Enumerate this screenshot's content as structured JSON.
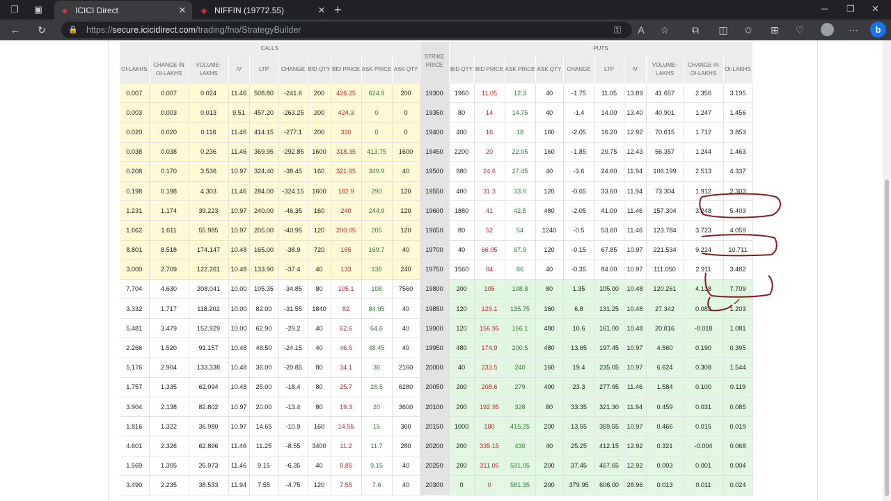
{
  "browser": {
    "tabs": [
      {
        "title": "ICICI Direct",
        "active": true
      },
      {
        "title": "NIFFIN (19772.55)",
        "active": false
      }
    ],
    "url_prefix": "https://",
    "url_host": "secure.icicidirect.com",
    "url_path": "/trading/fno/StrategyBuilder"
  },
  "colors": {
    "accent": "#1a73e8",
    "itm_calls": "#fff9d6",
    "itm_puts": "#e2f7e1",
    "bid_price": "#c62828",
    "ask_price": "#2e7d32",
    "annotation": "#8b1a1a"
  },
  "option_chain": {
    "calls_label": "CALLS",
    "puts_label": "PUTS",
    "headers": [
      "OI-LAKHS",
      "CHANGE IN OI-LAKHS",
      "VOLUME-LAKHS",
      "IV",
      "LTP",
      "CHANGE",
      "BID QTY",
      "BID PRICE",
      "ASK PRICE",
      "ASK QTY",
      "STRIKE PRICE",
      "BID QTY",
      "BID PRICE",
      "ASK PRICE",
      "ASK QTY",
      "CHANGE",
      "LTP",
      "IV",
      "VOLUME-LAKHS",
      "CHANGE IN OI-LAKHS",
      "OI-LAKHS"
    ],
    "rows": [
      [
        "0.007",
        "0.007",
        "0.024",
        "11.46",
        "508.80",
        "-241.6",
        "200",
        "426.25",
        "624.9",
        "200",
        "19300",
        "1960",
        "11.05",
        "12.3",
        "40",
        "-1.75",
        "11.05",
        "13.89",
        "41.657",
        "2.356",
        "3.195"
      ],
      [
        "0.003",
        "0.003",
        "0.013",
        "9.51",
        "457.20",
        "-263.25",
        "200",
        "424.3",
        "0",
        "0",
        "19350",
        "80",
        "14",
        "14.75",
        "40",
        "-1.4",
        "14.00",
        "13.40",
        "40.901",
        "1.247",
        "1.456"
      ],
      [
        "0.020",
        "0.020",
        "0.116",
        "11.46",
        "414.15",
        "-277.1",
        "200",
        "320",
        "0",
        "0",
        "19400",
        "400",
        "16",
        "18",
        "160",
        "-2.05",
        "16.20",
        "12.92",
        "70.615",
        "1.712",
        "3.853"
      ],
      [
        "0.038",
        "0.038",
        "0.236",
        "11.46",
        "369.95",
        "-292.85",
        "1600",
        "318.35",
        "413.75",
        "1600",
        "19450",
        "2200",
        "20",
        "22.05",
        "160",
        "-1.85",
        "20.75",
        "12.43",
        "56.357",
        "1.244",
        "1.463"
      ],
      [
        "0.208",
        "0.170",
        "3.536",
        "10.97",
        "324.40",
        "-38.45",
        "160",
        "321.95",
        "349.9",
        "40",
        "19500",
        "880",
        "24.6",
        "27.45",
        "40",
        "-3.6",
        "24.60",
        "11.94",
        "106.199",
        "2.513",
        "4.337"
      ],
      [
        "0.198",
        "0.198",
        "4.303",
        "11.46",
        "284.00",
        "-324.15",
        "1600",
        "182.9",
        "290",
        "120",
        "19550",
        "400",
        "31.3",
        "33.6",
        "120",
        "-0.65",
        "33.60",
        "11.94",
        "73.304",
        "1.912",
        "2.303"
      ],
      [
        "1.231",
        "1.174",
        "39.223",
        "10.97",
        "240.00",
        "-46.35",
        "160",
        "240",
        "244.9",
        "120",
        "19600",
        "1880",
        "41",
        "42.5",
        "480",
        "-2.05",
        "41.00",
        "11.46",
        "157.304",
        "3.248",
        "5.403"
      ],
      [
        "1.662",
        "1.611",
        "55.985",
        "10.97",
        "205.00",
        "-40.95",
        "120",
        "200.05",
        "205",
        "120",
        "19650",
        "80",
        "52",
        "54",
        "1240",
        "-0.5",
        "53.60",
        "11.46",
        "123.784",
        "3.723",
        "4.059"
      ],
      [
        "8.801",
        "8.518",
        "174.147",
        "10.48",
        "165.00",
        "-38.9",
        "720",
        "165",
        "169.7",
        "40",
        "19700",
        "40",
        "66.05",
        "67.9",
        "120",
        "-0.15",
        "67.85",
        "10.97",
        "221.534",
        "9.224",
        "10.711"
      ],
      [
        "3.000",
        "2.709",
        "122.261",
        "10.48",
        "133.90",
        "-37.4",
        "40",
        "133",
        "138",
        "240",
        "19750",
        "1560",
        "84",
        "86",
        "40",
        "-0.35",
        "84.00",
        "10.97",
        "111.050",
        "2.911",
        "3.482"
      ],
      [
        "7.704",
        "4.630",
        "208.041",
        "10.00",
        "105.35",
        "-34.85",
        "80",
        "105.1",
        "108",
        "7560",
        "19800",
        "200",
        "105",
        "108.8",
        "80",
        "1.35",
        "105.00",
        "10.48",
        "120.261",
        "4.138",
        "7.709"
      ],
      [
        "3.332",
        "1.717",
        "118.202",
        "10.00",
        "82.00",
        "-31.55",
        "1840",
        "82",
        "84.95",
        "40",
        "19850",
        "120",
        "129.1",
        "135.75",
        "160",
        "6.8",
        "131.25",
        "10.48",
        "27.342",
        "0.083",
        "1.203"
      ],
      [
        "5.481",
        "3.479",
        "152.929",
        "10.00",
        "62.90",
        "-29.2",
        "40",
        "62.6",
        "64.6",
        "40",
        "19900",
        "120",
        "156.95",
        "166.1",
        "480",
        "10.6",
        "161.00",
        "10.48",
        "20.816",
        "-0.018",
        "1.081"
      ],
      [
        "2.266",
        "1.520",
        "91.157",
        "10.48",
        "48.50",
        "-24.15",
        "40",
        "46.5",
        "48.45",
        "40",
        "19950",
        "480",
        "174.9",
        "200.5",
        "480",
        "13.65",
        "197.45",
        "10.97",
        "4.560",
        "0.190",
        "0.395"
      ],
      [
        "5.176",
        "2.904",
        "133.338",
        "10.48",
        "36.00",
        "-20.85",
        "80",
        "34.1",
        "36",
        "2160",
        "20000",
        "40",
        "233.5",
        "240",
        "160",
        "19.4",
        "235.05",
        "10.97",
        "6.624",
        "0.308",
        "1.544"
      ],
      [
        "1.757",
        "1.335",
        "62.094",
        "10.48",
        "25.00",
        "-18.4",
        "80",
        "25.7",
        "26.5",
        "6280",
        "20050",
        "200",
        "208.6",
        "279",
        "400",
        "23.3",
        "277.95",
        "11.46",
        "1.584",
        "0.100",
        "0.119"
      ],
      [
        "3.904",
        "2.138",
        "82.802",
        "10.97",
        "20.00",
        "-13.4",
        "80",
        "19.3",
        "20",
        "3600",
        "20100",
        "200",
        "192.95",
        "328",
        "80",
        "33.35",
        "321.30",
        "11.94",
        "0.459",
        "0.031",
        "0.085"
      ],
      [
        "1.816",
        "1.322",
        "36.980",
        "10.97",
        "14.65",
        "-10.9",
        "160",
        "14.55",
        "15",
        "360",
        "20150",
        "1000",
        "180",
        "415.25",
        "200",
        "13.55",
        "359.55",
        "10.97",
        "0.466",
        "0.015",
        "0.019"
      ],
      [
        "4.601",
        "2.326",
        "62.896",
        "11.46",
        "11.25",
        "-8.55",
        "3400",
        "11.2",
        "11.7",
        "280",
        "20200",
        "200",
        "335.15",
        "430",
        "40",
        "25.25",
        "412.15",
        "12.92",
        "0.321",
        "-0.004",
        "0.068"
      ],
      [
        "1.569",
        "1.305",
        "26.973",
        "11.46",
        "9.15",
        "-6.35",
        "40",
        "8.85",
        "9.15",
        "40",
        "20250",
        "200",
        "311.05",
        "531.05",
        "200",
        "37.45",
        "457.65",
        "12.92",
        "0.003",
        "0.001",
        "0.004"
      ],
      [
        "3.490",
        "2.235",
        "38.533",
        "11.94",
        "7.55",
        "-4.75",
        "120",
        "7.55",
        "7.6",
        "40",
        "20300",
        "0",
        "0",
        "581.35",
        "200",
        "379.95",
        "606.00",
        "28.96",
        "0.013",
        "0.011",
        "0.024"
      ]
    ]
  }
}
